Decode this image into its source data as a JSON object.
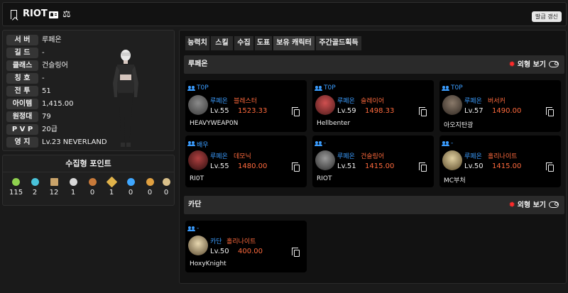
{
  "header": {
    "name": "RIOT",
    "refresh_label": "발급 갱신"
  },
  "profile": {
    "rows": [
      {
        "label": "서 버",
        "value": "루페온"
      },
      {
        "label": "길 드",
        "value": "-"
      },
      {
        "label": "클래스",
        "value": "건슬링어"
      },
      {
        "label": "칭 호",
        "value": "-"
      },
      {
        "label": "전 투",
        "value": "51"
      },
      {
        "label": "아이템",
        "value": "1,415.00"
      },
      {
        "label": "원정대",
        "value": "79"
      },
      {
        "label": "P V P",
        "value": "20급"
      },
      {
        "label": "영 지",
        "value": "Lv.23 NEVERLAND"
      }
    ]
  },
  "collect": {
    "title": "수집형 포인트",
    "items": [
      {
        "icon": "island-heart-icon",
        "value": "115",
        "color": "#8fd14f"
      },
      {
        "icon": "orb-icon",
        "value": "2",
        "color": "#49c2d9"
      },
      {
        "icon": "painting-icon",
        "value": "12",
        "color": "#c9a36a"
      },
      {
        "icon": "seed-icon",
        "value": "1",
        "color": "#d8d8d8"
      },
      {
        "icon": "star-icon",
        "value": "0",
        "color": "#c87a3a"
      },
      {
        "icon": "leaf-icon",
        "value": "1",
        "color": "#e0b24a"
      },
      {
        "icon": "flower-icon",
        "value": "0",
        "color": "#3fa7ff"
      },
      {
        "icon": "sun-icon",
        "value": "0",
        "color": "#e0a040"
      },
      {
        "icon": "coin-icon",
        "value": "0",
        "color": "#d9c08a"
      }
    ]
  },
  "tabs": [
    "능력치",
    "스킬",
    "수집",
    "도표",
    "보유 캐릭터",
    "주간골드획득"
  ],
  "appearance_label": "외형 보기",
  "groups": [
    {
      "server": "루페온",
      "cards": [
        {
          "cls": "T0P",
          "server": "루페온",
          "class": "블레스터",
          "lv": "Lv.55",
          "item": "1523.33",
          "name": "HEAVYWEAP0N",
          "avatar": "#5a5a5a"
        },
        {
          "cls": "T0P",
          "server": "루페온",
          "class": "슬레이어",
          "lv": "Lv.59",
          "item": "1498.33",
          "name": "Hellbenter",
          "avatar": "#b03a3a"
        },
        {
          "cls": "T0P",
          "server": "루페온",
          "class": "버서커",
          "lv": "Lv.57",
          "item": "1490.00",
          "name": "아오지탄광",
          "avatar": "#5b4a3a"
        },
        {
          "cls": "배우",
          "server": "루페온",
          "class": "데모닉",
          "lv": "Lv.55",
          "item": "1480.00",
          "name": "RI0T",
          "avatar": "#8a2a2a"
        },
        {
          "cls": "-",
          "server": "루페온",
          "class": "건슬링어",
          "lv": "Lv.51",
          "item": "1415.00",
          "name": "RIOT",
          "avatar": "#6a6a6a"
        },
        {
          "cls": "-",
          "server": "루페온",
          "class": "홀리나이트",
          "lv": "Lv.50",
          "item": "1415.00",
          "name": "MC부처",
          "avatar": "#b8a070"
        }
      ]
    },
    {
      "server": "카단",
      "cards": [
        {
          "cls": "-",
          "server": "카단",
          "class": "홀리나이트",
          "lv": "Lv.50",
          "item": "400.00",
          "name": "HoxyKnight",
          "avatar": "#c8b080"
        }
      ]
    }
  ]
}
